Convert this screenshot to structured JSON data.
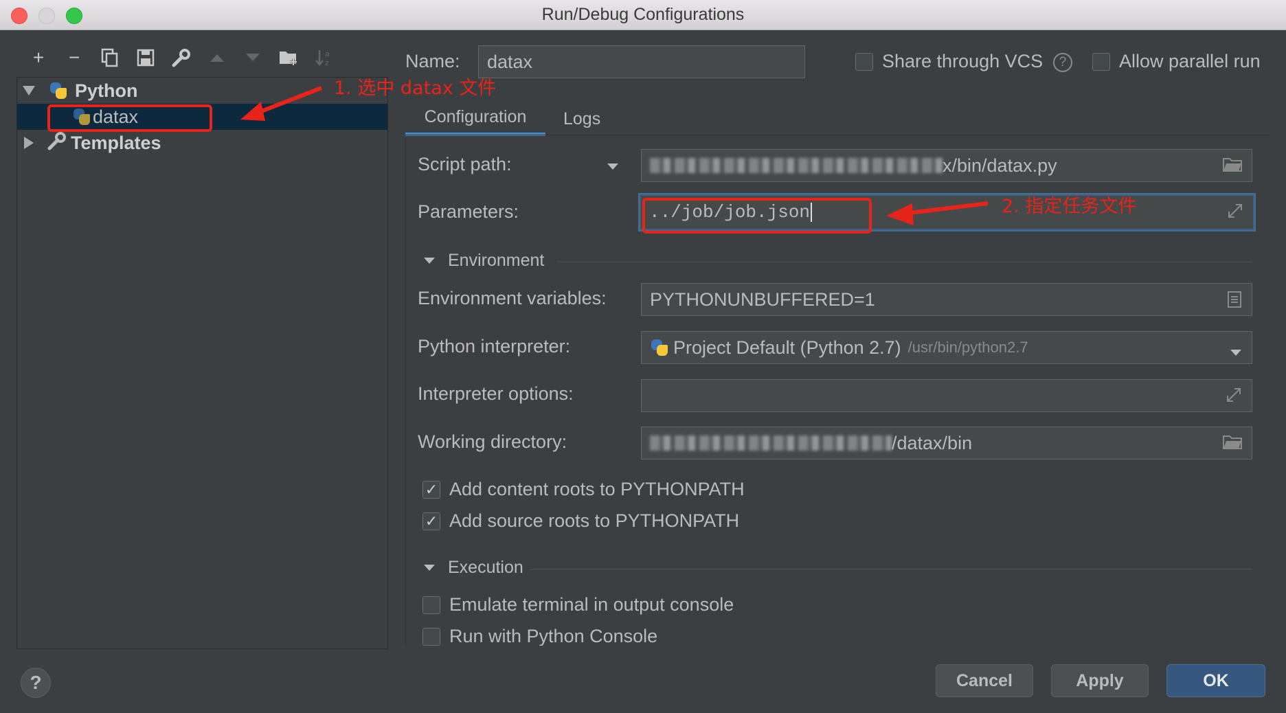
{
  "window": {
    "title": "Run/Debug Configurations"
  },
  "toolbar": {
    "add": "+",
    "remove": "−",
    "copy": "⧉",
    "save": "🖫",
    "edit": "🔧",
    "up": "▲",
    "down": "▼",
    "folder": "📁",
    "sort": "↓ᵃᶻ"
  },
  "tree": {
    "python": "Python",
    "datax": "datax",
    "templates": "Templates"
  },
  "header": {
    "name_label": "Name:",
    "name_value": "datax",
    "share_vcs": "Share through VCS",
    "allow_parallel": "Allow parallel run"
  },
  "tabs": {
    "configuration": "Configuration",
    "logs": "Logs"
  },
  "form": {
    "script_path_label": "Script path:",
    "script_path_value": "x/bin/datax.py",
    "parameters_label": "Parameters:",
    "parameters_value": "../job/job.json",
    "environment_section": "Environment",
    "env_vars_label": "Environment variables:",
    "env_vars_value": "PYTHONUNBUFFERED=1",
    "interpreter_label": "Python interpreter:",
    "interpreter_value": "Project Default (Python 2.7)",
    "interpreter_path": "/usr/bin/python2.7",
    "interp_options_label": "Interpreter options:",
    "interp_options_value": "",
    "working_dir_label": "Working directory:",
    "working_dir_value": "/datax/bin",
    "add_content_roots": "Add content roots to PYTHONPATH",
    "add_source_roots": "Add source roots to PYTHONPATH",
    "execution_section": "Execution",
    "emulate_terminal": "Emulate terminal in output console",
    "run_python_console": "Run with Python Console"
  },
  "annotations": {
    "step1": "1. 选中 datax 文件",
    "step2": "2. 指定任务文件"
  },
  "buttons": {
    "cancel": "Cancel",
    "apply": "Apply",
    "ok": "OK",
    "help": "?"
  }
}
